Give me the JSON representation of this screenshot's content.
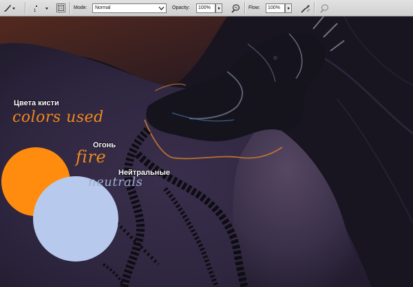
{
  "options_bar": {
    "brush_size": "1",
    "mode_label": "Mode:",
    "mode_value": "Normal",
    "opacity_label": "Opacity:",
    "opacity_value": "100%",
    "flow_label": "Flow:",
    "flow_value": "100%"
  },
  "canvas": {
    "annotations": {
      "brush_colors_ru": "Цвета кисти",
      "colors_used": "colors used",
      "fire_ru": "Огонь",
      "fire": "fire",
      "neutrals_ru": "Нейтральные",
      "neutrals": "neutrals"
    },
    "colors": {
      "fire_swatch": "#ff8c0f",
      "neutral_swatch": "#b7c9ec",
      "handwriting_orange": "#f08a1c",
      "handwriting_neutral": "#9daed0"
    }
  }
}
